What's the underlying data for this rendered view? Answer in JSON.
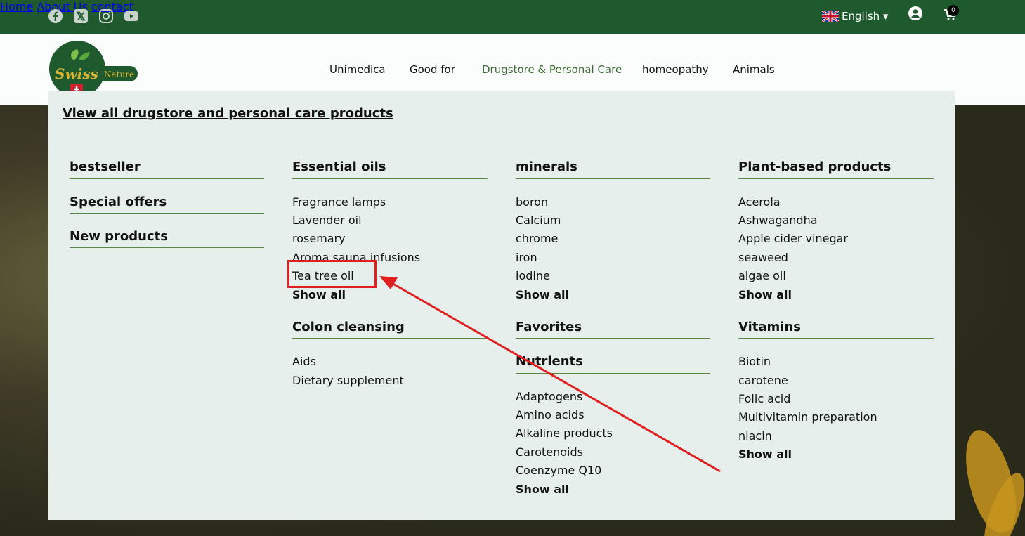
{
  "top_nav": {
    "social": [
      "facebook-icon",
      "x-twitter-icon",
      "instagram-icon",
      "youtube-icon"
    ],
    "home": "Home",
    "about": "About Us",
    "contact": "contact",
    "language": "English ▾",
    "cart_count": "0"
  },
  "logo": {
    "word1": "Swiss",
    "word2": "Nature"
  },
  "main_nav": {
    "unimedica": "Unimedica",
    "good_for": "Good for",
    "drugstore": "Drugstore & Personal Care",
    "homeopathy": "homeopathy",
    "animals": "Animals"
  },
  "mega": {
    "view_all": "View all drugstore and personal care products",
    "col1": {
      "bestseller": "bestseller",
      "special": "Special offers",
      "new": "New products"
    },
    "essential": {
      "title": "Essential oils",
      "items": [
        "Fragrance lamps",
        "Lavender oil",
        "rosemary",
        "Aroma sauna infusions",
        "Tea tree oil"
      ],
      "show_all": "Show all"
    },
    "colon": {
      "title": "Colon cleansing",
      "items": [
        "Aids",
        "Dietary supplement"
      ]
    },
    "minerals": {
      "title": "minerals",
      "items": [
        "boron",
        "Calcium",
        "chrome",
        "iron",
        "iodine"
      ],
      "show_all": "Show all"
    },
    "favorites": {
      "title": "Favorites"
    },
    "nutrients": {
      "title": "Nutrients",
      "items": [
        "Adaptogens",
        "Amino acids",
        "Alkaline products",
        "Carotenoids",
        "Coenzyme Q10"
      ],
      "show_all": "Show all"
    },
    "plant": {
      "title": "Plant-based products",
      "items": [
        "Acerola",
        "Ashwagandha",
        "Apple cider vinegar",
        "seaweed",
        "algae oil"
      ],
      "show_all": "Show all"
    },
    "vitamins": {
      "title": "Vitamins",
      "items": [
        "Biotin",
        "carotene",
        "Folic acid",
        "Multivitamin preparation",
        "niacin"
      ],
      "show_all": "Show all"
    }
  },
  "colors": {
    "topbar": "#1e5a2d",
    "accent": "#3d6b35",
    "menu_bg": "#e6efec",
    "annotation": "#e02020"
  }
}
